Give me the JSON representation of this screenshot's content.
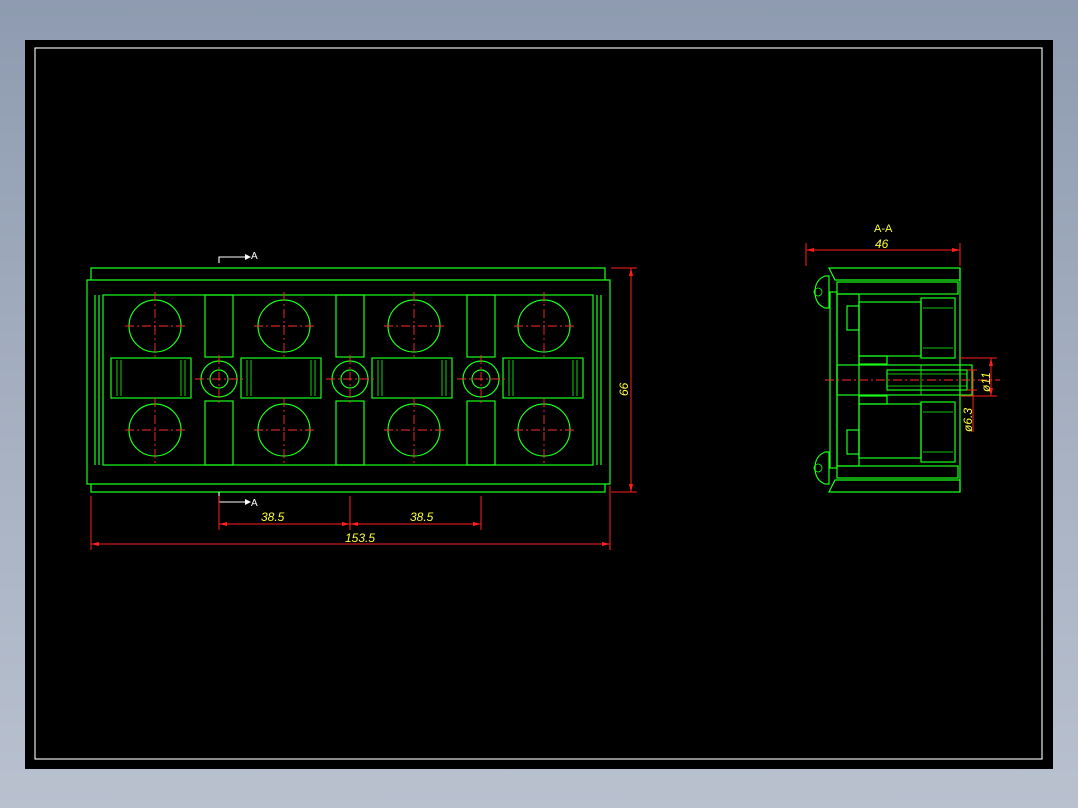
{
  "drawing": {
    "section_label": "A-A",
    "section_mark_top": "A",
    "section_mark_bottom": "A",
    "dimensions": {
      "pitch_1": "38.5",
      "pitch_2": "38.5",
      "overall_length": "153.5",
      "overall_height": "66",
      "section_width": "46",
      "hole_diameter_large": "ø11",
      "hole_diameter_small": "ø6.3"
    },
    "colors": {
      "background": "#000000",
      "outline": "#19ff19",
      "centerline": "#ff2b2b",
      "dimension_line": "#ff1f1f",
      "dimension_text": "#ffff33",
      "frame": "#ffffff"
    }
  }
}
